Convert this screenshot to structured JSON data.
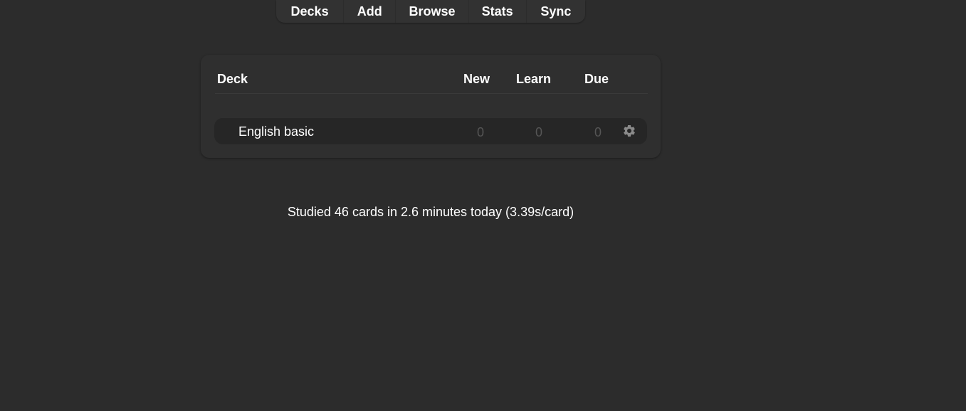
{
  "toolbar": {
    "items": [
      "Decks",
      "Add",
      "Browse",
      "Stats",
      "Sync"
    ]
  },
  "deck_table": {
    "headers": {
      "deck": "Deck",
      "new": "New",
      "learn": "Learn",
      "due": "Due"
    },
    "rows": [
      {
        "name": "English basic",
        "new": "0",
        "learn": "0",
        "due": "0",
        "options_icon": "gear-icon"
      }
    ]
  },
  "summary": "Studied 46 cards in 2.6 minutes today (3.39s/card)",
  "colors": {
    "background": "#2c2c2c",
    "panel": "#2f2f2f",
    "row": "#262626",
    "muted_count": "#555555",
    "text": "#ffffff"
  }
}
